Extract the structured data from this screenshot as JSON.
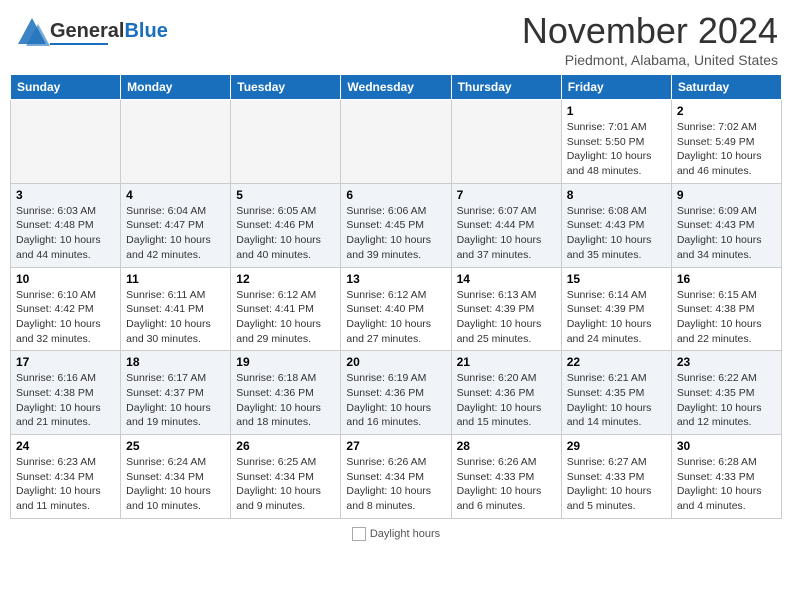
{
  "header": {
    "logo_text_general": "General",
    "logo_text_blue": "Blue",
    "month": "November 2024",
    "location": "Piedmont, Alabama, United States"
  },
  "calendar": {
    "days_of_week": [
      "Sunday",
      "Monday",
      "Tuesday",
      "Wednesday",
      "Thursday",
      "Friday",
      "Saturday"
    ],
    "weeks": [
      [
        {
          "day": "",
          "empty": true
        },
        {
          "day": "",
          "empty": true
        },
        {
          "day": "",
          "empty": true
        },
        {
          "day": "",
          "empty": true
        },
        {
          "day": "",
          "empty": true
        },
        {
          "day": "1",
          "sunrise": "Sunrise: 7:01 AM",
          "sunset": "Sunset: 5:50 PM",
          "daylight": "Daylight: 10 hours and 48 minutes."
        },
        {
          "day": "2",
          "sunrise": "Sunrise: 7:02 AM",
          "sunset": "Sunset: 5:49 PM",
          "daylight": "Daylight: 10 hours and 46 minutes."
        }
      ],
      [
        {
          "day": "3",
          "sunrise": "Sunrise: 6:03 AM",
          "sunset": "Sunset: 4:48 PM",
          "daylight": "Daylight: 10 hours and 44 minutes."
        },
        {
          "day": "4",
          "sunrise": "Sunrise: 6:04 AM",
          "sunset": "Sunset: 4:47 PM",
          "daylight": "Daylight: 10 hours and 42 minutes."
        },
        {
          "day": "5",
          "sunrise": "Sunrise: 6:05 AM",
          "sunset": "Sunset: 4:46 PM",
          "daylight": "Daylight: 10 hours and 40 minutes."
        },
        {
          "day": "6",
          "sunrise": "Sunrise: 6:06 AM",
          "sunset": "Sunset: 4:45 PM",
          "daylight": "Daylight: 10 hours and 39 minutes."
        },
        {
          "day": "7",
          "sunrise": "Sunrise: 6:07 AM",
          "sunset": "Sunset: 4:44 PM",
          "daylight": "Daylight: 10 hours and 37 minutes."
        },
        {
          "day": "8",
          "sunrise": "Sunrise: 6:08 AM",
          "sunset": "Sunset: 4:43 PM",
          "daylight": "Daylight: 10 hours and 35 minutes."
        },
        {
          "day": "9",
          "sunrise": "Sunrise: 6:09 AM",
          "sunset": "Sunset: 4:43 PM",
          "daylight": "Daylight: 10 hours and 34 minutes."
        }
      ],
      [
        {
          "day": "10",
          "sunrise": "Sunrise: 6:10 AM",
          "sunset": "Sunset: 4:42 PM",
          "daylight": "Daylight: 10 hours and 32 minutes."
        },
        {
          "day": "11",
          "sunrise": "Sunrise: 6:11 AM",
          "sunset": "Sunset: 4:41 PM",
          "daylight": "Daylight: 10 hours and 30 minutes."
        },
        {
          "day": "12",
          "sunrise": "Sunrise: 6:12 AM",
          "sunset": "Sunset: 4:41 PM",
          "daylight": "Daylight: 10 hours and 29 minutes."
        },
        {
          "day": "13",
          "sunrise": "Sunrise: 6:12 AM",
          "sunset": "Sunset: 4:40 PM",
          "daylight": "Daylight: 10 hours and 27 minutes."
        },
        {
          "day": "14",
          "sunrise": "Sunrise: 6:13 AM",
          "sunset": "Sunset: 4:39 PM",
          "daylight": "Daylight: 10 hours and 25 minutes."
        },
        {
          "day": "15",
          "sunrise": "Sunrise: 6:14 AM",
          "sunset": "Sunset: 4:39 PM",
          "daylight": "Daylight: 10 hours and 24 minutes."
        },
        {
          "day": "16",
          "sunrise": "Sunrise: 6:15 AM",
          "sunset": "Sunset: 4:38 PM",
          "daylight": "Daylight: 10 hours and 22 minutes."
        }
      ],
      [
        {
          "day": "17",
          "sunrise": "Sunrise: 6:16 AM",
          "sunset": "Sunset: 4:38 PM",
          "daylight": "Daylight: 10 hours and 21 minutes."
        },
        {
          "day": "18",
          "sunrise": "Sunrise: 6:17 AM",
          "sunset": "Sunset: 4:37 PM",
          "daylight": "Daylight: 10 hours and 19 minutes."
        },
        {
          "day": "19",
          "sunrise": "Sunrise: 6:18 AM",
          "sunset": "Sunset: 4:36 PM",
          "daylight": "Daylight: 10 hours and 18 minutes."
        },
        {
          "day": "20",
          "sunrise": "Sunrise: 6:19 AM",
          "sunset": "Sunset: 4:36 PM",
          "daylight": "Daylight: 10 hours and 16 minutes."
        },
        {
          "day": "21",
          "sunrise": "Sunrise: 6:20 AM",
          "sunset": "Sunset: 4:36 PM",
          "daylight": "Daylight: 10 hours and 15 minutes."
        },
        {
          "day": "22",
          "sunrise": "Sunrise: 6:21 AM",
          "sunset": "Sunset: 4:35 PM",
          "daylight": "Daylight: 10 hours and 14 minutes."
        },
        {
          "day": "23",
          "sunrise": "Sunrise: 6:22 AM",
          "sunset": "Sunset: 4:35 PM",
          "daylight": "Daylight: 10 hours and 12 minutes."
        }
      ],
      [
        {
          "day": "24",
          "sunrise": "Sunrise: 6:23 AM",
          "sunset": "Sunset: 4:34 PM",
          "daylight": "Daylight: 10 hours and 11 minutes."
        },
        {
          "day": "25",
          "sunrise": "Sunrise: 6:24 AM",
          "sunset": "Sunset: 4:34 PM",
          "daylight": "Daylight: 10 hours and 10 minutes."
        },
        {
          "day": "26",
          "sunrise": "Sunrise: 6:25 AM",
          "sunset": "Sunset: 4:34 PM",
          "daylight": "Daylight: 10 hours and 9 minutes."
        },
        {
          "day": "27",
          "sunrise": "Sunrise: 6:26 AM",
          "sunset": "Sunset: 4:34 PM",
          "daylight": "Daylight: 10 hours and 8 minutes."
        },
        {
          "day": "28",
          "sunrise": "Sunrise: 6:26 AM",
          "sunset": "Sunset: 4:33 PM",
          "daylight": "Daylight: 10 hours and 6 minutes."
        },
        {
          "day": "29",
          "sunrise": "Sunrise: 6:27 AM",
          "sunset": "Sunset: 4:33 PM",
          "daylight": "Daylight: 10 hours and 5 minutes."
        },
        {
          "day": "30",
          "sunrise": "Sunrise: 6:28 AM",
          "sunset": "Sunset: 4:33 PM",
          "daylight": "Daylight: 10 hours and 4 minutes."
        }
      ]
    ]
  },
  "footer": {
    "daylight_label": "Daylight hours"
  }
}
